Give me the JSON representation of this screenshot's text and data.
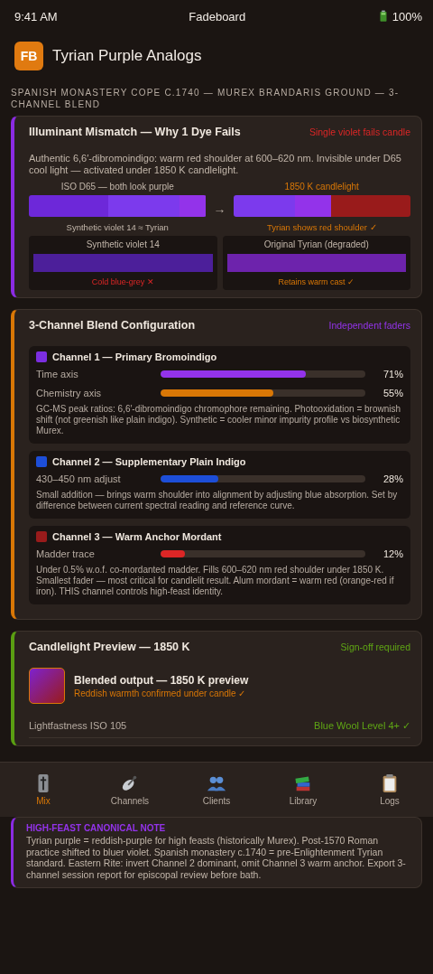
{
  "status_bar": {
    "time": "9:41 AM",
    "title": "Fadeboard",
    "battery": "100%"
  },
  "header": {
    "logo": "FB",
    "title": "Tyrian Purple Analogs"
  },
  "caption": "SPANISH MONASTERY COPE C.1740 — MUREX BRANDARIS GROUND — 3-CHANNEL BLEND",
  "mismatch": {
    "title": "Illuminant Mismatch — Why 1 Dye Fails",
    "badge": "Single violet fails candle",
    "text": "Authentic 6,6′-dibromoindigo: warm red shoulder at 600–620 nm. Invisible under D65 cool light — activated under 1850 K candlelight.",
    "compare": [
      {
        "label": "ISO D65 — both look purple",
        "kind": "d65",
        "caption": "Synthetic violet 14 ≈ Tyrian"
      },
      {
        "label": "1850 K candlelight",
        "kind": "candle",
        "caption": "Tyrian shows red shoulder ✓"
      }
    ],
    "arrow": "→",
    "swatches": [
      {
        "label": "Synthetic violet 14",
        "color": "#4c1f9a",
        "verdict": "Cold blue-grey ✕",
        "pass": false
      },
      {
        "label": "Original Tyrian (degraded)",
        "color": "#6d23ac",
        "verdict": "Retains warm cast ✓",
        "pass": true
      }
    ]
  },
  "blend": {
    "title": "3-Channel Blend Configuration",
    "badge": "Independent faders",
    "channels": [
      {
        "name": "Channel 1 — Primary Bromoindigo",
        "color": "#7b2ee0",
        "faders": [
          {
            "label": "Time axis",
            "level": 0.71,
            "reading": "71%",
            "color": "#9333ea"
          },
          {
            "label": "Chemistry axis",
            "level": 0.55,
            "reading": "55%",
            "color": "#d97706"
          }
        ],
        "note": "GC-MS peak ratios: 6,6′-dibromoindigo chromophore remaining. Photooxidation = brownish shift (not greenish like plain indigo). Synthetic = cooler minor impurity profile vs biosynthetic Murex."
      },
      {
        "name": "Channel 2 — Supplementary Plain Indigo",
        "color": "#1d4ed8",
        "faders": [
          {
            "label": "430–450 nm adjust",
            "level": 0.28,
            "reading": "28%",
            "color": "#1d4ed8"
          }
        ],
        "note": "Small addition — brings warm shoulder into alignment by adjusting blue absorption. Set by difference between current spectral reading and reference curve."
      },
      {
        "name": "Channel 3 — Warm Anchor Mordant",
        "color": "#991b1b",
        "faders": [
          {
            "label": "Madder trace",
            "level": 0.12,
            "reading": "12%",
            "color": "#dc2626"
          }
        ],
        "note": "Under 0.5% w.o.f. co-mordanted madder. Fills 600–620 nm red shoulder under 1850 K. Smallest fader — most critical for candlelit result. Alum mordant = warm red (orange-red if iron). THIS channel controls high-feast identity."
      }
    ]
  },
  "preview": {
    "title": "Candlelight Preview — 1850 K",
    "badge": "Sign-off required",
    "output_title": "Blended output — 1850 K preview",
    "output_note": "Reddish warmth confirmed under candle ✓",
    "rows": [
      {
        "label": "Lightfastness ISO 105",
        "value": "Blue Wool Level 4+ ✓"
      }
    ]
  },
  "tabs": [
    {
      "label": "Mix",
      "kind": "cross",
      "selected": true
    },
    {
      "label": "Channels",
      "kind": "dish",
      "selected": false
    },
    {
      "label": "Clients",
      "kind": "people",
      "selected": false
    },
    {
      "label": "Library",
      "kind": "books",
      "selected": false
    },
    {
      "label": "Logs",
      "kind": "clipboard",
      "selected": false
    }
  ],
  "note": {
    "title": "HIGH-FEAST CANONICAL NOTE",
    "text": "Tyrian purple = reddish-purple for high feasts (historically Murex). Post-1570 Roman practice shifted to bluer violet. Spanish monastery c.1740 = pre-Enlightenment Tyrian standard. Eastern Rite: invert Channel 2 dominant, omit Channel 3 warm anchor. Export 3-channel session report for episcopal review before bath."
  }
}
